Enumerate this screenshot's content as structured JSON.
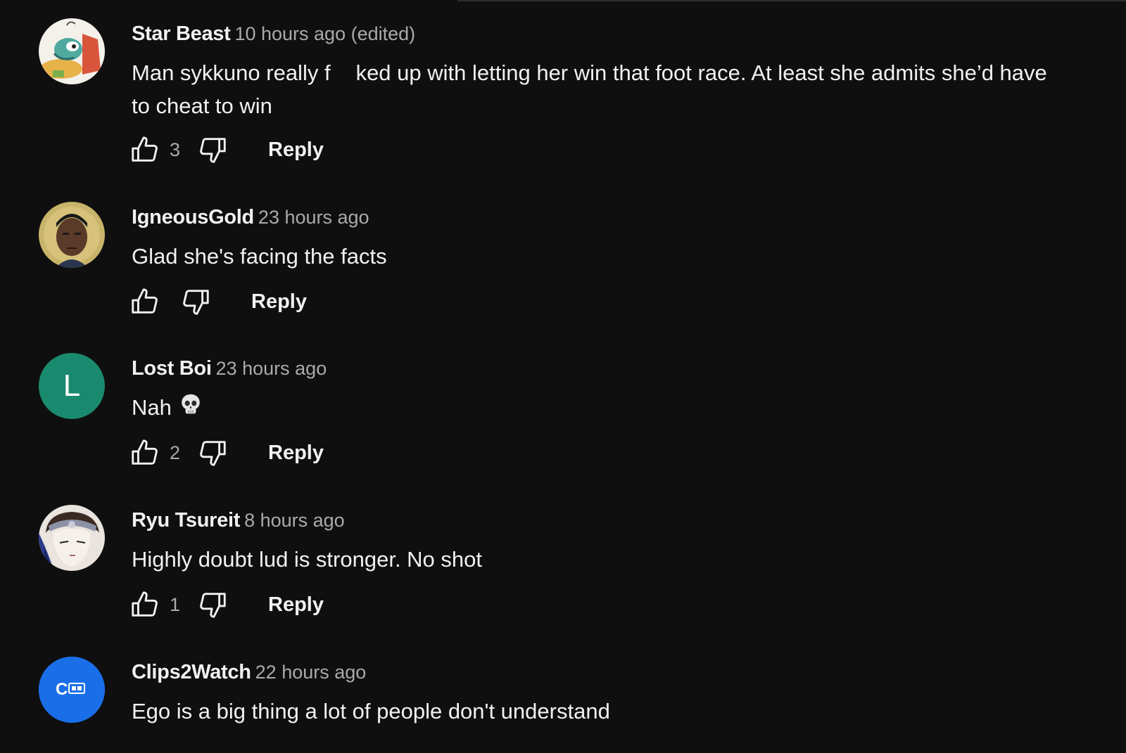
{
  "comments": [
    {
      "author": "Star Beast",
      "time": "10 hours ago (edited)",
      "text_before": "Man sykkuno really f",
      "text_after": "ked up with letting her win that foot race. At least she admits she’d have to cheat to win",
      "likes": "3",
      "reply_label": "Reply",
      "avatar": "cartoon-avatar"
    },
    {
      "author": "IgneousGold",
      "time": "23 hours ago",
      "text": "Glad she's facing the facts",
      "likes": "",
      "reply_label": "Reply",
      "avatar": "game-character-avatar"
    },
    {
      "author": "Lost Boi",
      "time": "23 hours ago",
      "text": "Nah",
      "emoji": "skull-emoji",
      "likes": "2",
      "reply_label": "Reply",
      "avatar_letter": "L",
      "avatar_color": "#1a8a6e"
    },
    {
      "author": "Ryu Tsureit",
      "time": "8 hours ago",
      "text": "Highly doubt lud is stronger. No shot",
      "likes": "1",
      "reply_label": "Reply",
      "avatar": "anime-avatar"
    },
    {
      "author": "Clips2Watch",
      "time": "22 hours ago",
      "text": "Ego is a big thing a lot of people don't understand",
      "avatar_letter": "C",
      "avatar_color": "#1a6fe8"
    }
  ],
  "colors": {
    "background": "#0f0f0f",
    "primary_text": "#f1f1f1",
    "secondary_text": "#aaaaaa"
  }
}
